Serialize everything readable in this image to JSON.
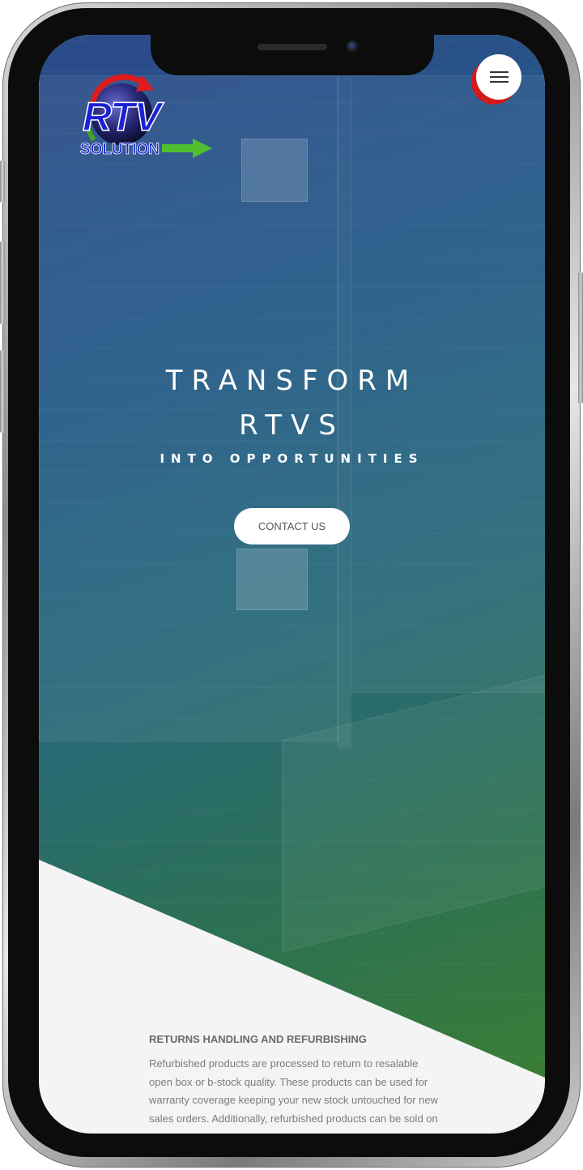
{
  "brand": {
    "logo_main": "RTV",
    "logo_sub": "SOLUTION",
    "colors": {
      "logo_blue": "#1a22d6",
      "arrow_red": "#e01b1b",
      "arrow_green": "#4fbf2e"
    }
  },
  "header": {
    "menu_icon": "hamburger-menu-icon",
    "menu_accent": "#d21a1a"
  },
  "hero": {
    "title_line1": "TRANSFORM",
    "title_line2": "RTVS",
    "subtitle": "INTO OPPORTUNITIES",
    "cta_label": "CONTACT US",
    "gradient": {
      "start": "#2b4a8a",
      "end": "#3b7d34"
    }
  },
  "section": {
    "heading": "RETURNS HANDLING AND REFURBISHING",
    "body_lines": [
      "Refurbished products are processed to return to resalable",
      "open box or b-stock quality. These products can be used for",
      "warranty coverage keeping your new stock untouched for new",
      "sales orders. Additionally, refurbished products can be sold on"
    ]
  }
}
